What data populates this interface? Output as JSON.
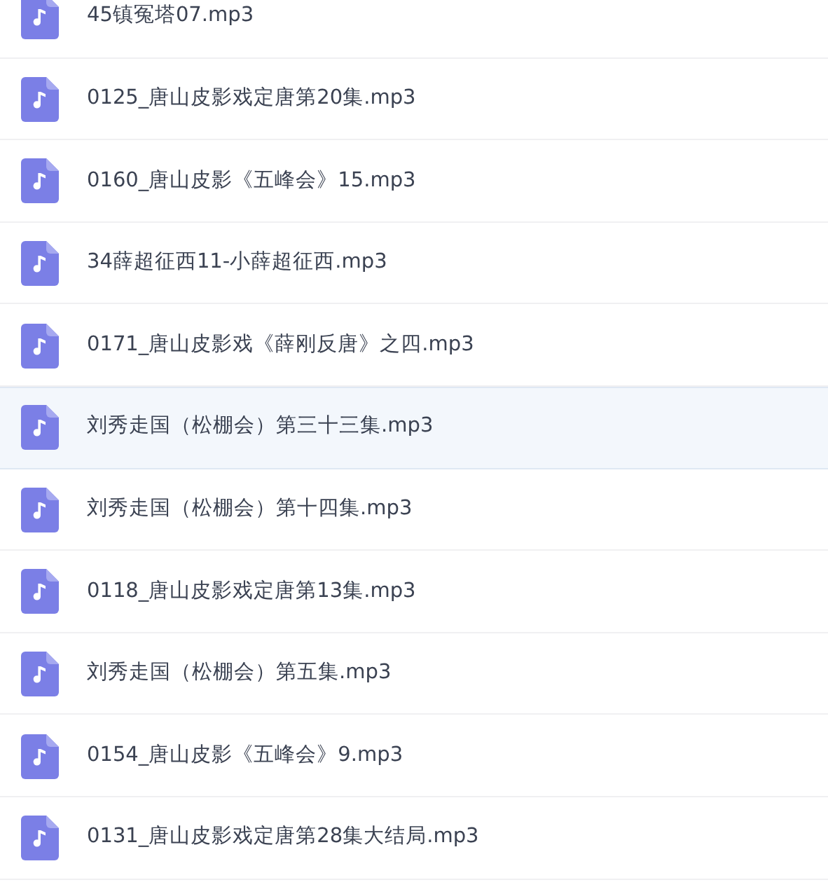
{
  "files": [
    {
      "name": "45镇冤塔07.mp3",
      "selected": false
    },
    {
      "name": "0125_唐山皮影戏定唐第20集.mp3",
      "selected": false
    },
    {
      "name": "0160_唐山皮影《五峰会》15.mp3",
      "selected": false
    },
    {
      "name": "34薛超征西11-小薛超征西.mp3",
      "selected": false
    },
    {
      "name": "0171_唐山皮影戏《薛刚反唐》之四.mp3",
      "selected": false
    },
    {
      "name": "刘秀走国（松棚会）第三十三集.mp3",
      "selected": true
    },
    {
      "name": "刘秀走国（松棚会）第十四集.mp3",
      "selected": false
    },
    {
      "name": "0118_唐山皮影戏定唐第13集.mp3",
      "selected": false
    },
    {
      "name": "刘秀走国（松棚会）第五集.mp3",
      "selected": false
    },
    {
      "name": "0154_唐山皮影《五峰会》9.mp3",
      "selected": false
    },
    {
      "name": "0131_唐山皮影戏定唐第28集大结局.mp3",
      "selected": false
    }
  ]
}
